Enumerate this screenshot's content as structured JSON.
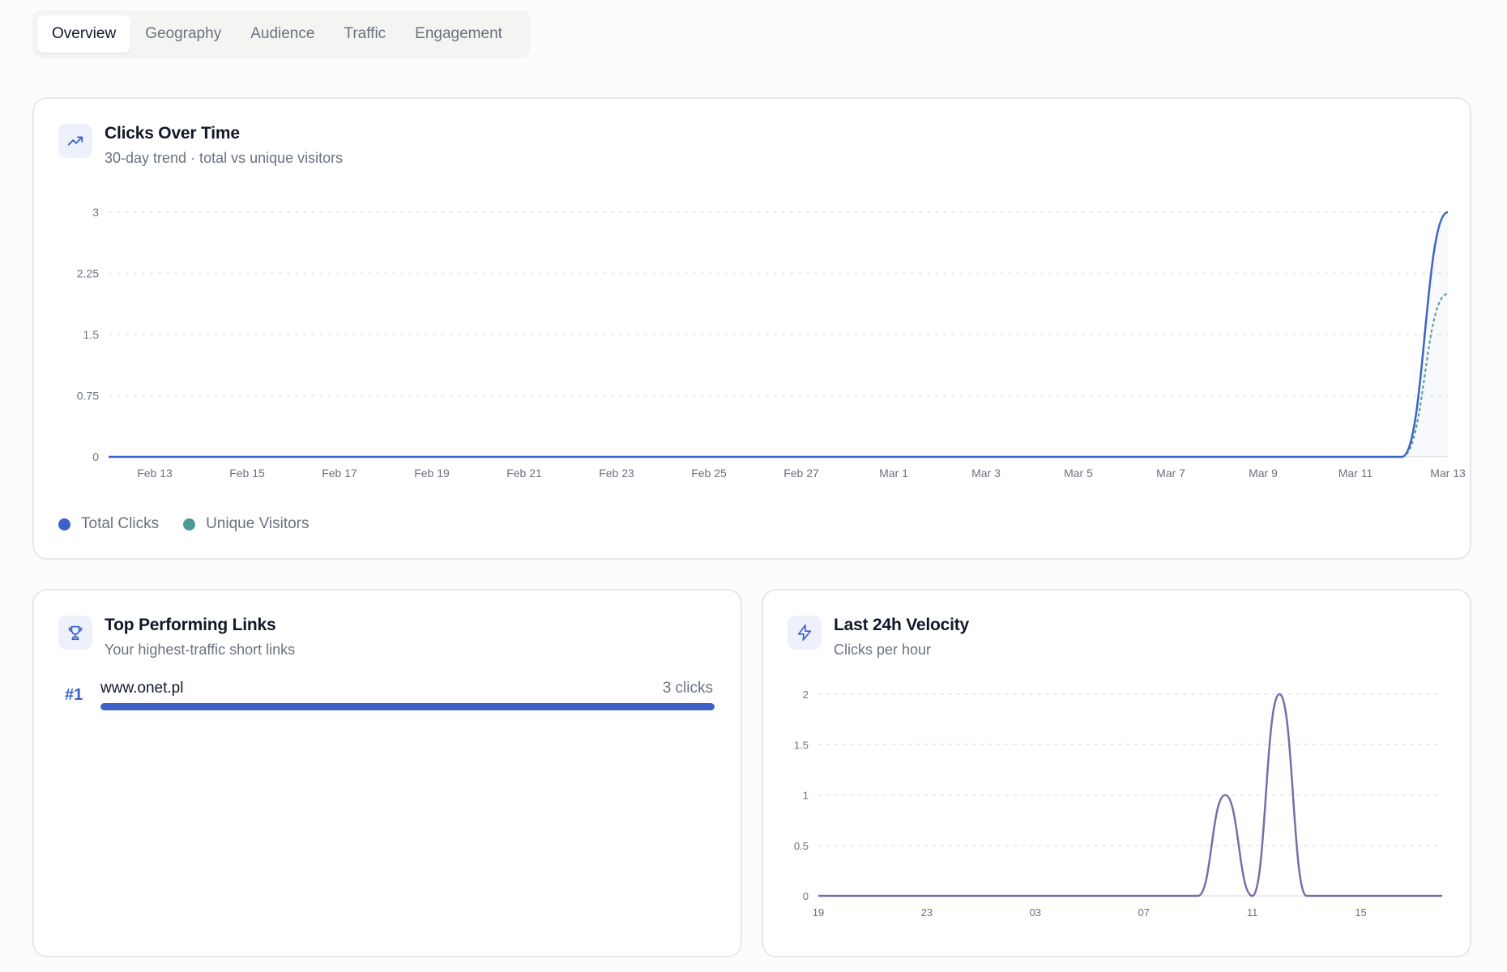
{
  "tabs": [
    {
      "label": "Overview",
      "active": true
    },
    {
      "label": "Geography",
      "active": false
    },
    {
      "label": "Audience",
      "active": false
    },
    {
      "label": "Traffic",
      "active": false
    },
    {
      "label": "Engagement",
      "active": false
    }
  ],
  "clicks_card": {
    "title": "Clicks Over Time",
    "subtitle": "30-day trend · total vs unique visitors",
    "icon": "trending-up-icon"
  },
  "top_links_card": {
    "title": "Top Performing Links",
    "subtitle": "Your highest-traffic short links",
    "icon": "trophy-icon",
    "links": [
      {
        "rank": "#1",
        "url": "www.onet.pl",
        "clicks_label": "3 clicks",
        "share": 1.0
      }
    ]
  },
  "velocity_card": {
    "title": "Last 24h Velocity",
    "subtitle": "Clicks per hour",
    "icon": "lightning-icon"
  },
  "colors": {
    "total": "#3b63c7",
    "unique": "#4e9a96",
    "velocity": "#7c6ba8",
    "grid": "#e5e7eb",
    "tick": "#6b7280"
  },
  "chart_data": [
    {
      "type": "line",
      "x_tick_labels": [
        "Feb 13",
        "Feb 15",
        "Feb 17",
        "Feb 19",
        "Feb 21",
        "Feb 23",
        "Feb 25",
        "Feb 27",
        "Mar 1",
        "Mar 3",
        "Mar 5",
        "Mar 7",
        "Mar 9",
        "Mar 11",
        "Mar 13"
      ],
      "x_tick_days": [
        1,
        3,
        5,
        7,
        9,
        11,
        13,
        15,
        17,
        19,
        21,
        23,
        25,
        27,
        29
      ],
      "x_range_days": [
        0,
        29
      ],
      "y_ticks": [
        0,
        0.75,
        1.5,
        2.25,
        3
      ],
      "ylim": [
        0,
        3
      ],
      "grid": true,
      "legend": "bottom-left",
      "series": [
        {
          "name": "Total Clicks",
          "style": "solid",
          "values": [
            0,
            0,
            0,
            0,
            0,
            0,
            0,
            0,
            0,
            0,
            0,
            0,
            0,
            0,
            0,
            0,
            0,
            0,
            0,
            0,
            0,
            0,
            0,
            0,
            0,
            0,
            0,
            0,
            0,
            3
          ]
        },
        {
          "name": "Unique Visitors",
          "style": "dashed",
          "values": [
            0,
            0,
            0,
            0,
            0,
            0,
            0,
            0,
            0,
            0,
            0,
            0,
            0,
            0,
            0,
            0,
            0,
            0,
            0,
            0,
            0,
            0,
            0,
            0,
            0,
            0,
            0,
            0,
            0,
            2
          ]
        }
      ]
    },
    {
      "type": "line",
      "x_tick_labels": [
        "19",
        "23",
        "03",
        "07",
        "11",
        "15"
      ],
      "x_tick_hours": [
        0,
        4,
        8,
        12,
        16,
        20
      ],
      "x_range_hours": [
        0,
        23
      ],
      "y_ticks": [
        0,
        0.5,
        1,
        1.5,
        2
      ],
      "ylim": [
        0,
        2
      ],
      "grid": true,
      "series": [
        {
          "values": [
            0,
            0,
            0,
            0,
            0,
            0,
            0,
            0,
            0,
            0,
            0,
            0,
            0,
            0,
            0,
            1,
            0,
            2,
            0,
            0,
            0,
            0,
            0,
            0
          ]
        }
      ]
    }
  ]
}
